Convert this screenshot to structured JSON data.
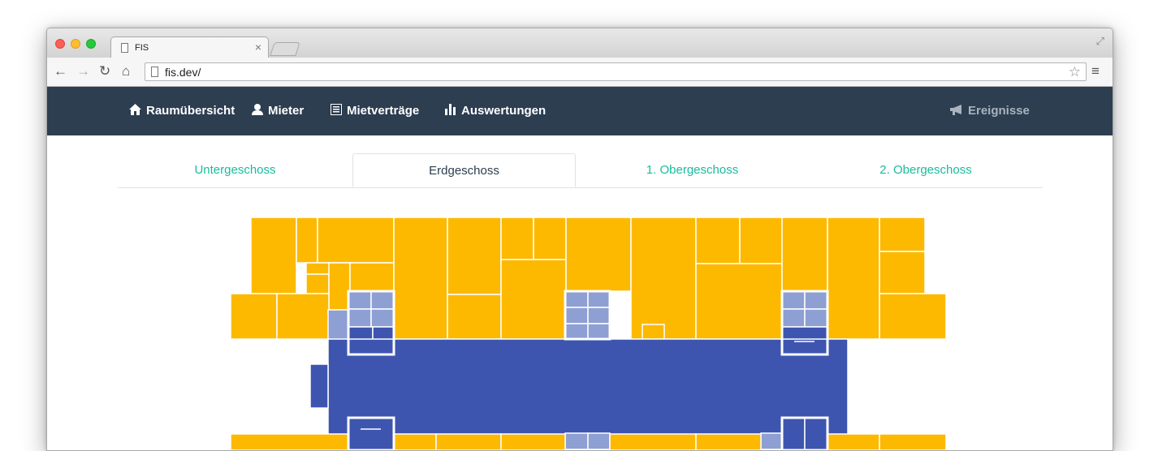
{
  "browser": {
    "tab_title": "FIS",
    "tab_close": "×",
    "url": "fis.dev/",
    "icons": [
      "back-arrow-icon",
      "forward-arrow-icon",
      "reload-icon",
      "home-icon",
      "page-icon",
      "star-icon",
      "menu-icon",
      "fullscreen-icon"
    ]
  },
  "navbar": {
    "items": [
      {
        "label": "Raumübersicht",
        "icon": "home-icon"
      },
      {
        "label": "Mieter",
        "icon": "user-icon"
      },
      {
        "label": "Mietverträge",
        "icon": "list-icon"
      },
      {
        "label": "Auswertungen",
        "icon": "bar-chart-icon"
      }
    ],
    "right": {
      "label": "Ereignisse",
      "icon": "bullhorn-icon"
    }
  },
  "floor_tabs": [
    {
      "label": "Untergeschoss",
      "active": false
    },
    {
      "label": "Erdgeschoss",
      "active": true
    },
    {
      "label": "1. Obergeschoss",
      "active": false
    },
    {
      "label": "2. Obergeschoss",
      "active": false
    }
  ],
  "colors": {
    "navbar": "#2c3e50",
    "link": "#18bc9c",
    "room_rented": "#fdb900",
    "core": "#3e55b0",
    "service": "#8e9fd3"
  }
}
